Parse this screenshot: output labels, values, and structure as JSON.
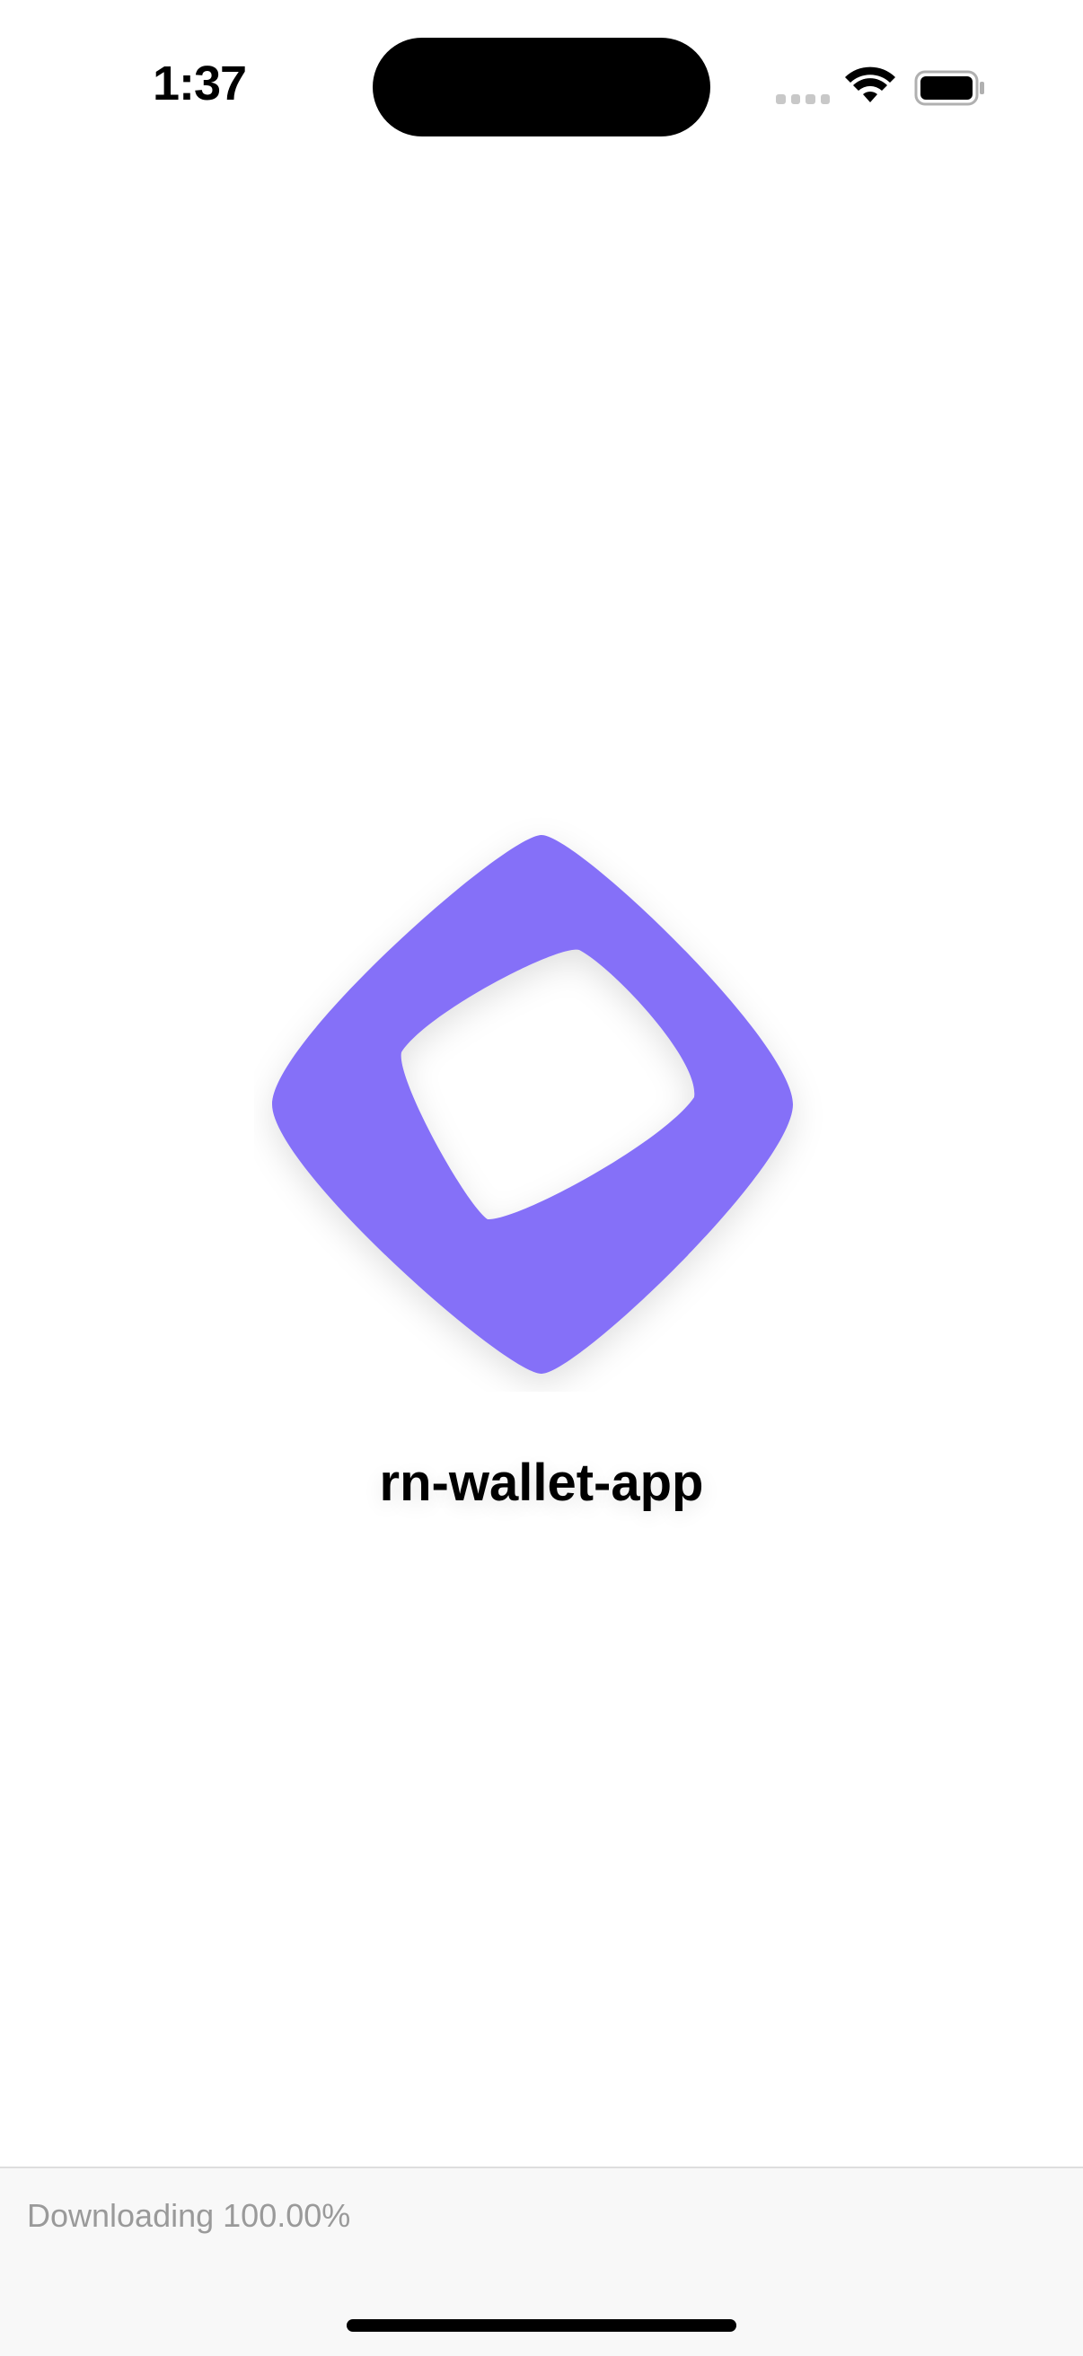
{
  "status_bar": {
    "time": "1:37",
    "icons": [
      "signal-icon",
      "wifi-icon",
      "battery-icon"
    ]
  },
  "splash": {
    "logo": "app-logo-icon",
    "title": "rn-wallet-app",
    "logo_color": "#8570f8"
  },
  "download": {
    "status_text": "Downloading 100.00%",
    "progress": 1.0
  }
}
